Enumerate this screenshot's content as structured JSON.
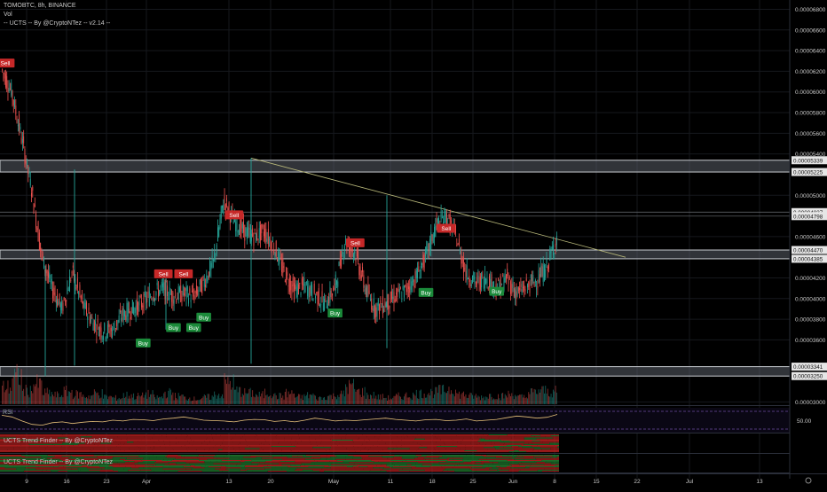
{
  "header": {
    "symbol_line": "TOMOBTC, 8h, BINANCE",
    "vol_label": "Vol",
    "indicator_line": "-- UCTS -- By @CryptoNTez -- v2.14 --"
  },
  "rsi": {
    "label": "RSI",
    "level_label": "50.00",
    "line_color": "#e8c27a",
    "band_color": "#6a4aa0"
  },
  "trend_panels": [
    {
      "label": "UCTS Trend Finder -- By @CryptoNTez"
    },
    {
      "label": "UCTS Trend Finder -- By @CryptoNTez"
    }
  ],
  "colors": {
    "up": "#26a69a",
    "down": "#ef5350",
    "zone": "#8a8f98",
    "trendline": "#b8b87a",
    "buy": "#1b8a3a",
    "sell": "#c62828",
    "background": "#000000"
  },
  "chart_data": {
    "type": "candlestick",
    "symbol": "TOMOBTC",
    "interval": "8h",
    "exchange": "BINANCE",
    "y_axis_ticks": [
      "0.00006800",
      "0.00006600",
      "0.00006400",
      "0.00006200",
      "0.00006000",
      "0.00005800",
      "0.00005600",
      "0.00005400",
      "0.00005000",
      "0.00004600",
      "0.00004200",
      "0.00004000",
      "0.00003800",
      "0.00003600",
      "0.00003000"
    ],
    "y_axis_tick_values": [
      6.8e-05,
      6.6e-05,
      6.4e-05,
      6.2e-05,
      6e-05,
      5.8e-05,
      5.6e-05,
      5.4e-05,
      5e-05,
      4.6e-05,
      4.2e-05,
      4e-05,
      3.8e-05,
      3.6e-05,
      3e-05
    ],
    "price_levels": [
      "0.00005339",
      "0.00005225",
      "0.00004837",
      "0.00004798",
      "0.00004470",
      "0.00004385",
      "0.00003341",
      "0.00003250"
    ],
    "price_level_values": [
      5.339e-05,
      5.225e-05,
      4.837e-05,
      4.798e-05,
      4.47e-05,
      4.385e-05,
      3.341e-05,
      3.25e-05
    ],
    "x_axis_ticks": [
      "9",
      "16",
      "23",
      "Apr",
      "13",
      "20",
      "May",
      "11",
      "18",
      "25",
      "Jun",
      "8",
      "15",
      "22",
      "Jul",
      "13"
    ],
    "ylim": [
      2.96e-05,
      6.89e-05
    ],
    "support_resistance_zones": [
      {
        "from": 5.225e-05,
        "to": 5.339e-05
      },
      {
        "from": 4.385e-05,
        "to": 4.47e-05
      },
      {
        "from": 3.25e-05,
        "to": 3.341e-05
      }
    ],
    "trendline": {
      "from_price": 5.36e-05,
      "to_price": 4.4e-05
    },
    "price_path": [
      [
        6.22e-05,
        0
      ],
      [
        6e-05,
        0
      ],
      [
        5.55e-05,
        0
      ],
      [
        5.05e-05,
        0
      ],
      [
        4.4e-05,
        0
      ],
      [
        4.1e-05,
        0
      ],
      [
        3.9e-05,
        0
      ],
      [
        4.25e-05,
        0
      ],
      [
        3.95e-05,
        0
      ],
      [
        3.78e-05,
        0
      ],
      [
        3.68e-05,
        0
      ],
      [
        3.7e-05,
        0
      ],
      [
        3.85e-05,
        0
      ],
      [
        3.9e-05,
        0
      ],
      [
        3.96e-05,
        0
      ],
      [
        4.05e-05,
        0
      ],
      [
        4.1e-05,
        0
      ],
      [
        4.02e-05,
        0
      ],
      [
        4.05e-05,
        0
      ],
      [
        4.02e-05,
        0
      ],
      [
        4.15e-05,
        0
      ],
      [
        4.35e-05,
        0
      ],
      [
        4.95e-05,
        0
      ],
      [
        4.75e-05,
        0
      ],
      [
        4.65e-05,
        0
      ],
      [
        4.6e-05,
        0
      ],
      [
        4.65e-05,
        0
      ],
      [
        4.5e-05,
        0
      ],
      [
        4.25e-05,
        0
      ],
      [
        4.08e-05,
        0
      ],
      [
        4.12e-05,
        0
      ],
      [
        4.05e-05,
        0
      ],
      [
        3.95e-05,
        0
      ],
      [
        4.1e-05,
        0
      ],
      [
        4.55e-05,
        0
      ],
      [
        4.45e-05,
        0
      ],
      [
        4.1e-05,
        0
      ],
      [
        3.9e-05,
        0
      ],
      [
        3.95e-05,
        0
      ],
      [
        4.02e-05,
        0
      ],
      [
        4.08e-05,
        0
      ],
      [
        4.2e-05,
        0
      ],
      [
        4.4e-05,
        0
      ],
      [
        4.7e-05,
        0
      ],
      [
        4.8e-05,
        0
      ],
      [
        4.6e-05,
        0
      ],
      [
        4.25e-05,
        0
      ],
      [
        4.15e-05,
        0
      ],
      [
        4.2e-05,
        0
      ],
      [
        4.1e-05,
        0
      ],
      [
        4.2e-05,
        0
      ],
      [
        4.05e-05,
        0
      ],
      [
        4.12e-05,
        0
      ],
      [
        4.18e-05,
        0
      ],
      [
        4.3e-05,
        0
      ],
      [
        4.6e-05,
        0
      ]
    ],
    "volume_bars": [
      38,
      62,
      30,
      45,
      25,
      20,
      28,
      22,
      18,
      24,
      16,
      14,
      20,
      18,
      22,
      15,
      25,
      18,
      14,
      12,
      16,
      22,
      48,
      30,
      25,
      20,
      26,
      18,
      24,
      16,
      20,
      14,
      18,
      22,
      40,
      28,
      20,
      16,
      14,
      18,
      20,
      24,
      26,
      30,
      35,
      22,
      18,
      16,
      20,
      18,
      22,
      16,
      26,
      30,
      28,
      24
    ],
    "rsi_values": [
      62,
      58,
      48,
      40,
      38,
      44,
      46,
      42,
      45,
      47,
      46,
      50,
      48,
      52,
      51,
      49,
      53,
      55,
      58,
      54,
      50,
      49,
      48,
      46,
      50,
      52,
      51,
      47,
      49,
      46,
      50,
      55,
      52,
      48,
      50,
      49,
      51,
      53,
      55,
      52,
      50,
      48,
      51,
      52,
      49,
      50,
      53,
      48,
      50,
      52,
      56,
      60,
      58,
      55,
      57,
      64
    ],
    "signals": [
      {
        "label": "Sell",
        "kind": "sell",
        "bar": 0,
        "price": 6.22e-05
      },
      {
        "label": "Buy",
        "kind": "buy",
        "bar": 14,
        "price": 3.63e-05
      },
      {
        "label": "Sell",
        "kind": "sell",
        "bar": 16,
        "price": 4.18e-05
      },
      {
        "label": "Buy",
        "kind": "buy",
        "bar": 17,
        "price": 3.78e-05
      },
      {
        "label": "Sell",
        "kind": "sell",
        "bar": 18,
        "price": 4.18e-05
      },
      {
        "label": "Buy",
        "kind": "buy",
        "bar": 19,
        "price": 3.78e-05
      },
      {
        "label": "Buy",
        "kind": "buy",
        "bar": 20,
        "price": 3.88e-05
      },
      {
        "label": "Sell",
        "kind": "sell",
        "bar": 23,
        "price": 4.75e-05
      },
      {
        "label": "Buy",
        "kind": "buy",
        "bar": 33,
        "price": 3.92e-05
      },
      {
        "label": "Sell",
        "kind": "sell",
        "bar": 35,
        "price": 4.48e-05
      },
      {
        "label": "Buy",
        "kind": "buy",
        "bar": 42,
        "price": 4.12e-05
      },
      {
        "label": "Sell",
        "kind": "sell",
        "bar": 44,
        "price": 4.62e-05
      },
      {
        "label": "Buy",
        "kind": "buy",
        "bar": 49,
        "price": 4.13e-05
      }
    ]
  }
}
